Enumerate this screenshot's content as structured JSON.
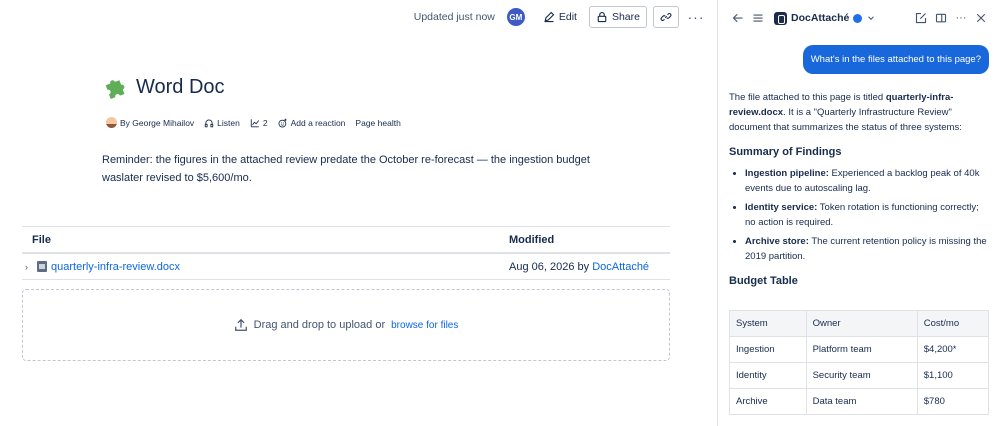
{
  "header": {
    "updated": "Updated just now",
    "avatar_initials": "GM",
    "edit_label": "Edit",
    "share_label": "Share",
    "more": "···"
  },
  "page": {
    "title": "Word Doc",
    "author": "By George Mihailov",
    "listen": "Listen",
    "analytics_count": "2",
    "reaction": "Add a reaction",
    "health": "Page health",
    "reminder": "Reminder: the figures in the attached review predate the October re-forecast — the ingestion budget waslater revised to $5,600/mo."
  },
  "file_table": {
    "headers": [
      "File",
      "Modified"
    ],
    "rows": [
      {
        "name": "quarterly-infra-review.docx",
        "modified": "Aug 06, 2026 by ",
        "modified_by": "DocAttaché"
      }
    ]
  },
  "dropzone": {
    "text": "Drag and drop to upload or",
    "browse": "browse for files"
  },
  "assistant": {
    "name": "DocAttaché",
    "question": "What's in the files attached to this page?",
    "intro_1": "The file attached to this page is titled ",
    "intro_bold": "quarterly-infra-review.docx",
    "intro_2": ". It is a \"Quarterly Infrastructure Review\" document that summarizes the status of three systems:",
    "summary_heading": "Summary of Findings",
    "findings": [
      {
        "label": "Ingestion pipeline:",
        "text": " Experienced a backlog peak of 40k events due to autoscaling lag."
      },
      {
        "label": "Identity service:",
        "text": " Token rotation is functioning correctly; no action is required."
      },
      {
        "label": "Archive store:",
        "text": " The current retention policy is missing the 2019 partition."
      }
    ],
    "budget_heading": "Budget Table",
    "budget": {
      "headers": [
        "System",
        "Owner",
        "Cost/mo"
      ],
      "rows": [
        [
          "Ingestion",
          "Platform team",
          "$4,200*"
        ],
        [
          "Identity",
          "Security team",
          "$1,100"
        ],
        [
          "Archive",
          "Data team",
          "$780"
        ]
      ]
    }
  },
  "colors": {
    "accent": "#1868db",
    "link": "#0c66e4",
    "avatar": "#3e5bc5"
  }
}
